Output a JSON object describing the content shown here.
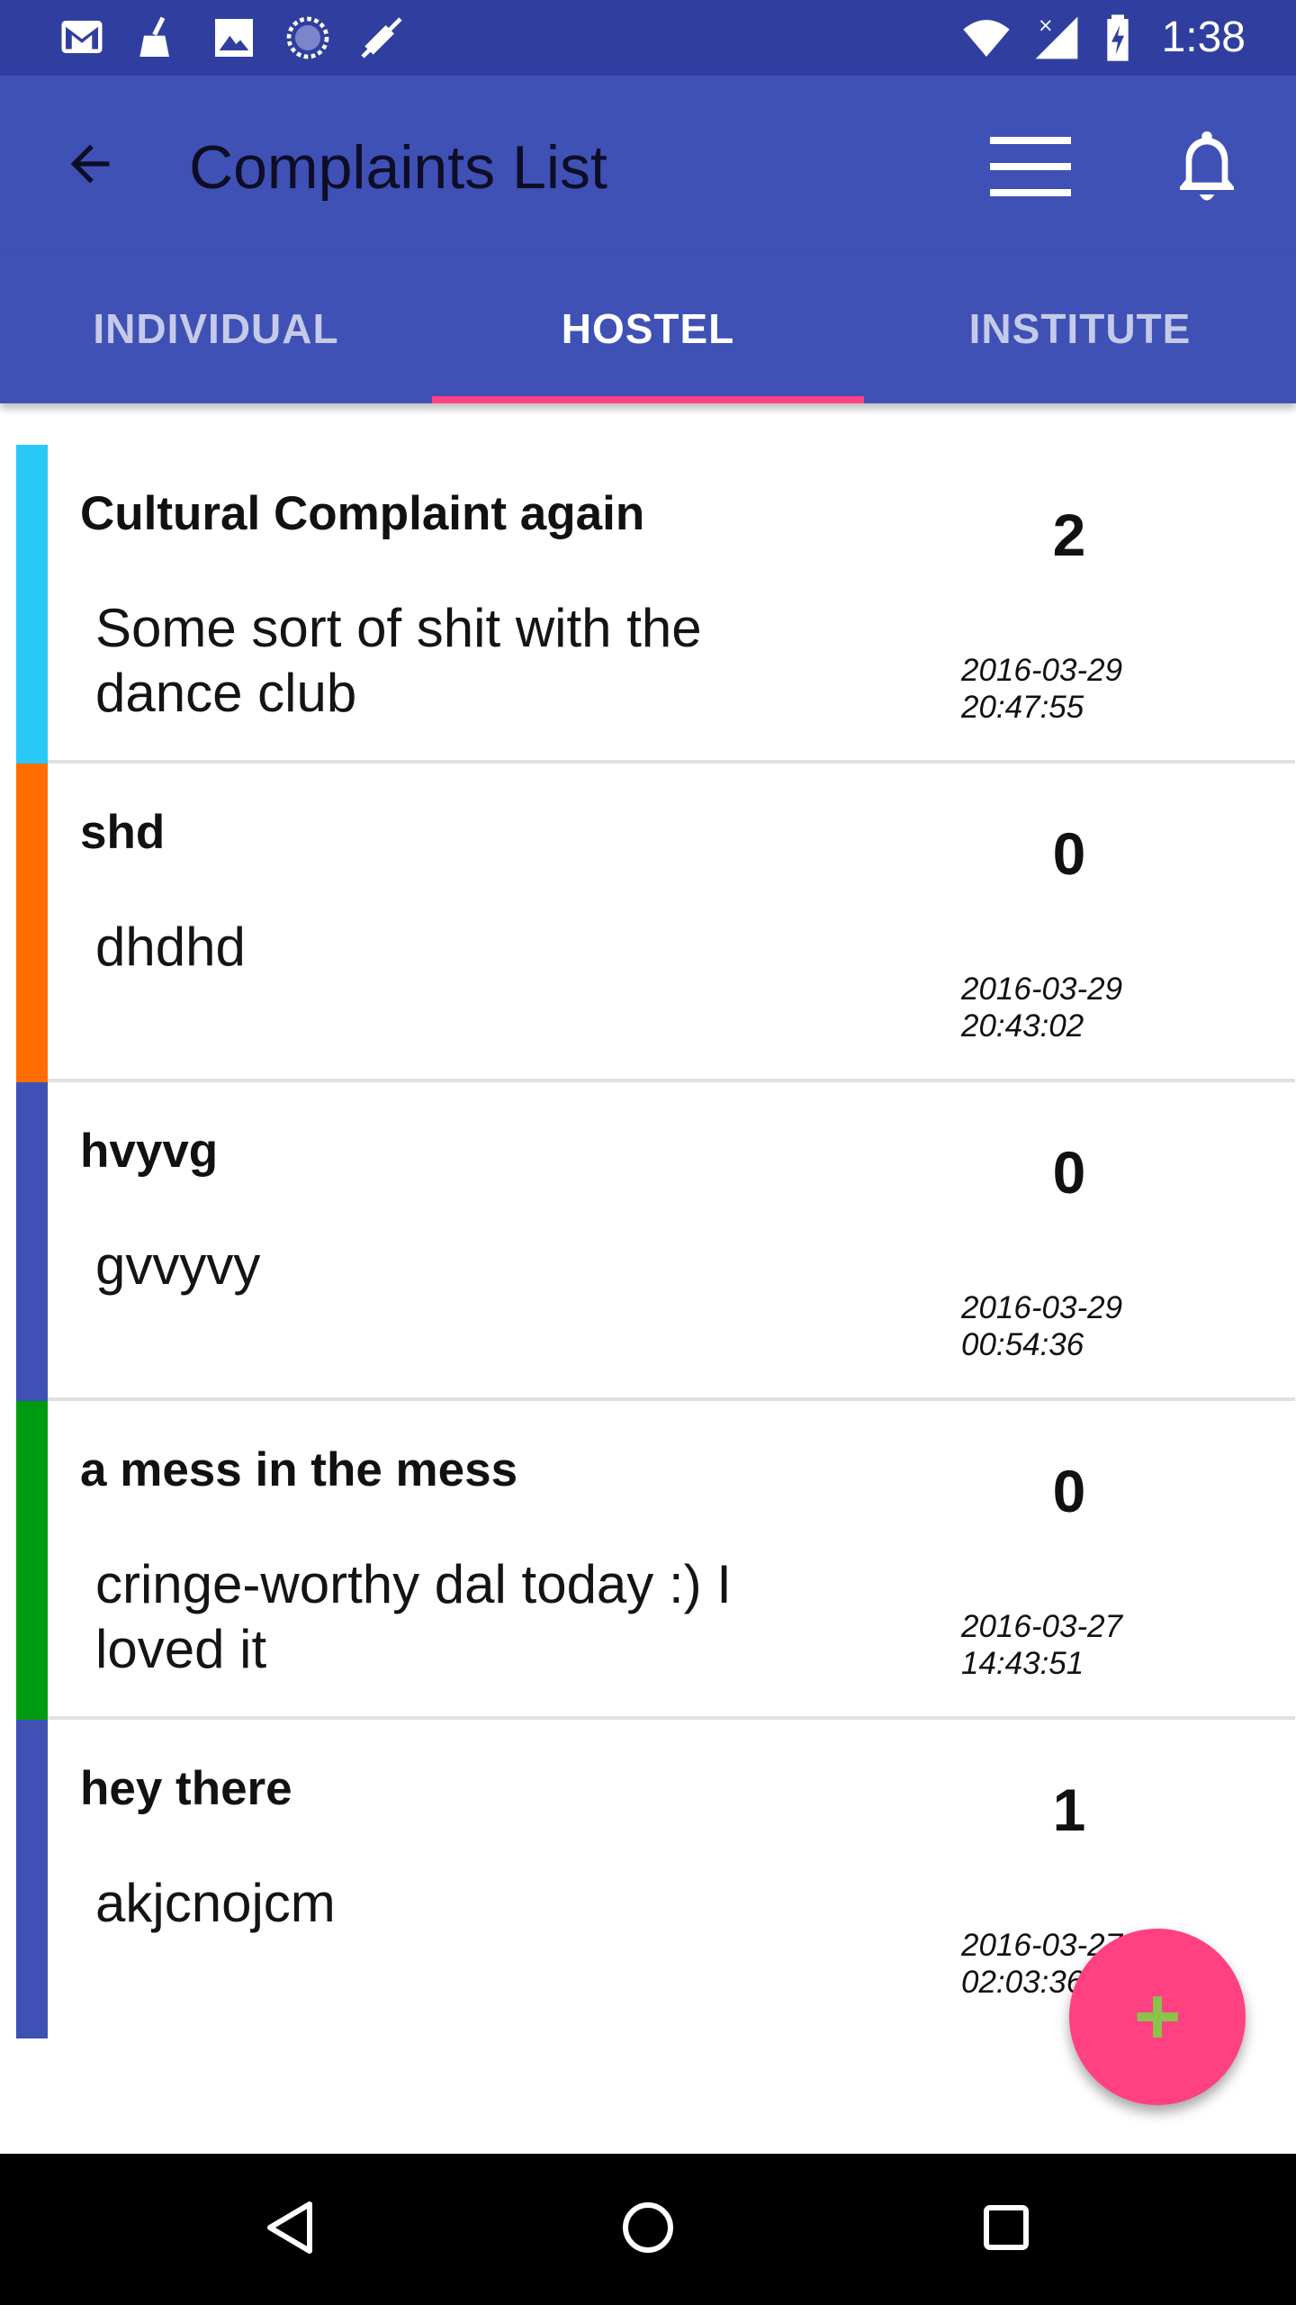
{
  "status_bar": {
    "time": "1:38",
    "left_icons": [
      "gmail-icon",
      "cleaner-icon",
      "image-icon",
      "sync-icon",
      "muted-icon"
    ],
    "right_icons": [
      "wifi-icon",
      "signal-icon",
      "battery-charging-icon"
    ]
  },
  "app_bar": {
    "title": "Complaints List"
  },
  "tabs": [
    {
      "label": "INDIVIDUAL",
      "active": false
    },
    {
      "label": "HOSTEL",
      "active": true
    },
    {
      "label": "INSTITUTE",
      "active": false
    }
  ],
  "complaints": [
    {
      "title": "Cultural Complaint again",
      "description": "Some sort of shit with the dance club",
      "count": "2",
      "date": "2016-03-29",
      "time": "20:47:55",
      "color": "#29c8f6"
    },
    {
      "title": "shd",
      "description": "dhdhd",
      "count": "0",
      "date": "2016-03-29",
      "time": "20:43:02",
      "color": "#ff6d00"
    },
    {
      "title": "hvyvg",
      "description": "gvvyvy",
      "count": "0",
      "date": "2016-03-29",
      "time": "00:54:36",
      "color": "#3f51b5"
    },
    {
      "title": "a mess in the mess",
      "description": "cringe-worthy dal today :) I loved it",
      "count": "0",
      "date": "2016-03-27",
      "time": "14:43:51",
      "color": "#009b10"
    },
    {
      "title": "hey there",
      "description": "akjcnojcm",
      "count": "1",
      "date": "2016-03-27",
      "time": "02:03:36",
      "color": "#3f51b5"
    }
  ],
  "fab": {
    "label": "+"
  },
  "colors": {
    "primary": "#3f51b5",
    "primary_dark": "#303f9f",
    "accent": "#ff4081"
  }
}
